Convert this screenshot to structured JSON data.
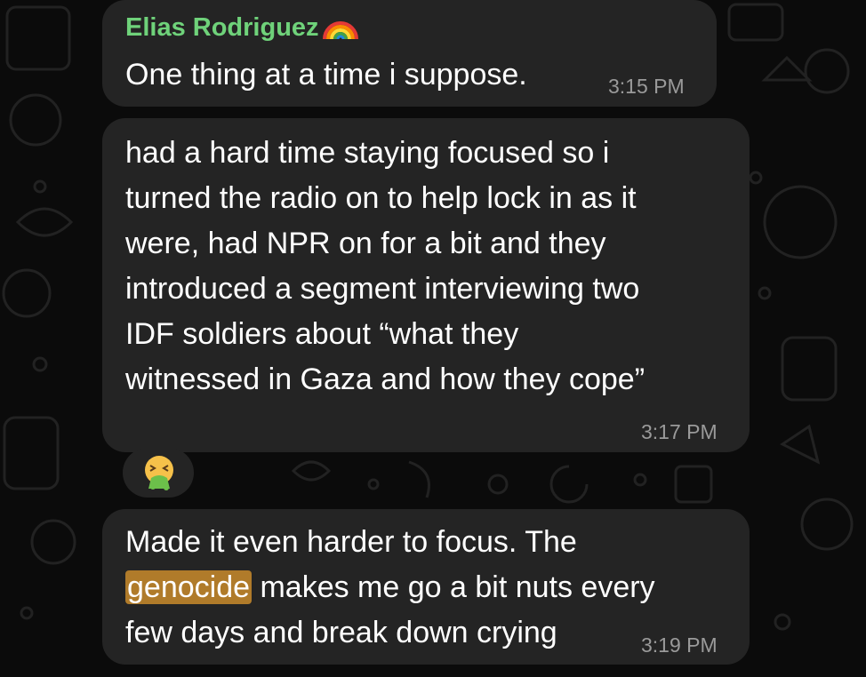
{
  "messages": [
    {
      "sender": "Elias Rodriguez",
      "lines": [
        "One thing at a time i suppose."
      ],
      "time": "3:15 PM"
    },
    {
      "lines": [
        "had a hard time staying focused so i",
        "turned the radio on to help lock in as it",
        "were, had NPR on for a bit and they",
        "introduced a segment interviewing two",
        "IDF soldiers about “what they",
        "witnessed in Gaza and how they cope”"
      ],
      "time": "3:17 PM",
      "reaction": "🤮"
    },
    {
      "lines": [
        "Made it even harder to focus. The",
        "makes me go a bit nuts every",
        "few days and break down crying"
      ],
      "highlight": "genocide",
      "time": "3:19 PM"
    }
  ],
  "colors": {
    "background": "#0b0b0b",
    "bubble": "#242424",
    "sender_name": "#6fd27a",
    "timestamp": "#9a9a9a",
    "highlight": "#b07b2a"
  }
}
